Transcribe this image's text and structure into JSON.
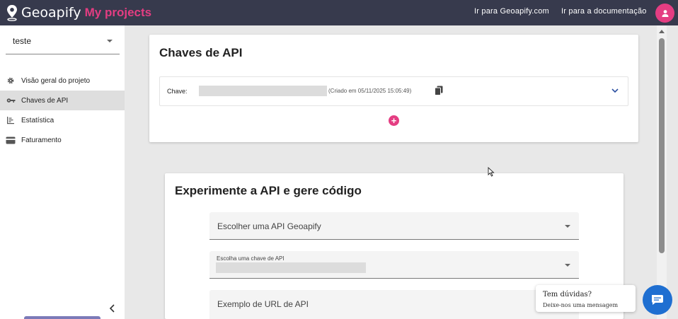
{
  "header": {
    "brand": "Geoapify",
    "section": "My projects",
    "links": [
      "Ir para Geoapify.com",
      "Ir para a documentação"
    ]
  },
  "sidebar": {
    "project": "teste",
    "items": [
      {
        "label": "Visão geral do projeto",
        "icon": "gear-icon"
      },
      {
        "label": "Chaves de API",
        "icon": "key-icon",
        "active": true
      },
      {
        "label": "Estatística",
        "icon": "bar-list-icon"
      },
      {
        "label": "Faturamento",
        "icon": "credit-card-icon"
      }
    ]
  },
  "api_keys": {
    "title": "Chaves de API",
    "key_label": "Chave:",
    "created": "(Criado em 05/11/2025 15:05:49)",
    "add_symbol": "+"
  },
  "playground": {
    "title": "Experimente a API e gere código",
    "api_select_label": "Escolher uma API Geoapify",
    "key_select_label": "Escolha uma chave de API",
    "url_label": "Exemplo de URL de API"
  },
  "chat": {
    "title": "Tem dúvidas?",
    "subtitle": "Deixe-nos uma mensagem"
  },
  "colors": {
    "topbar": "#373a4d",
    "accent": "#e43d82",
    "chat": "#1f6fd1"
  }
}
